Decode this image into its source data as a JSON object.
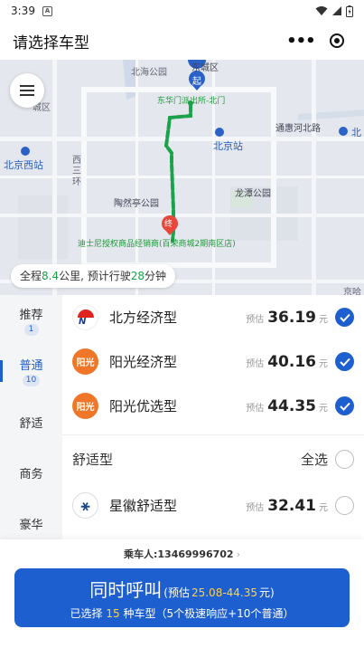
{
  "status_bar": {
    "time": "3:39",
    "notification_letter": "A"
  },
  "header": {
    "title": "请选择车型"
  },
  "map": {
    "labels": {
      "dongcheng": "东城区",
      "beihai": "北海公园",
      "start_marker": "起",
      "start_place": "东华门派出所-北门",
      "xicheng": "城区",
      "tonghui": "通惠河北路",
      "beijing_station": "北京站",
      "beijing_west": "北京西站",
      "xisanhuan": "西三环",
      "taoranting": "陶然亭公园",
      "longtan": "龙潭公园",
      "end_marker": "终",
      "end_place": "迪士尼授权商品经销商(百荣商城2期南区店)",
      "right_edge": "北",
      "bottom_right": "京哈"
    },
    "route_info": {
      "prefix": "全程",
      "distance": "8.4",
      "mid": "公里, 预计行驶",
      "duration": "28",
      "suffix": "分钟"
    }
  },
  "sidebar": {
    "items": [
      {
        "label": "推荐",
        "count": "1"
      },
      {
        "label": "普通",
        "count": "10"
      },
      {
        "label": "舒适"
      },
      {
        "label": "商务"
      },
      {
        "label": "豪华"
      }
    ]
  },
  "cars": {
    "estimate_label": "预估",
    "unit": "元",
    "items": [
      {
        "name": "北方经济型",
        "price": "36.19",
        "logo_text": "N"
      },
      {
        "name": "阳光经济型",
        "price": "40.16",
        "logo_text": "阳光"
      },
      {
        "name": "阳光优选型",
        "price": "44.35",
        "logo_text": "阳光"
      }
    ],
    "comfort_section": {
      "title": "舒适型",
      "select_all": "全选"
    },
    "comfort_items": [
      {
        "name": "星徽舒适型",
        "price": "32.41",
        "logo_text": "⚹"
      }
    ]
  },
  "bottom": {
    "passenger": "乘车人:13469996702",
    "call_main": "同时呼叫",
    "call_paren_open": "(预估",
    "call_range": "25.08-44.35",
    "call_paren_close": "元)",
    "selected_prefix": "已选择",
    "selected_count": "15",
    "selected_suffix": "种车型（5个极速响应+10个普通）"
  },
  "colors": {
    "accent": "#1e5fd0",
    "route": "#1aa34a",
    "price_highlight": "#ffd24a"
  }
}
